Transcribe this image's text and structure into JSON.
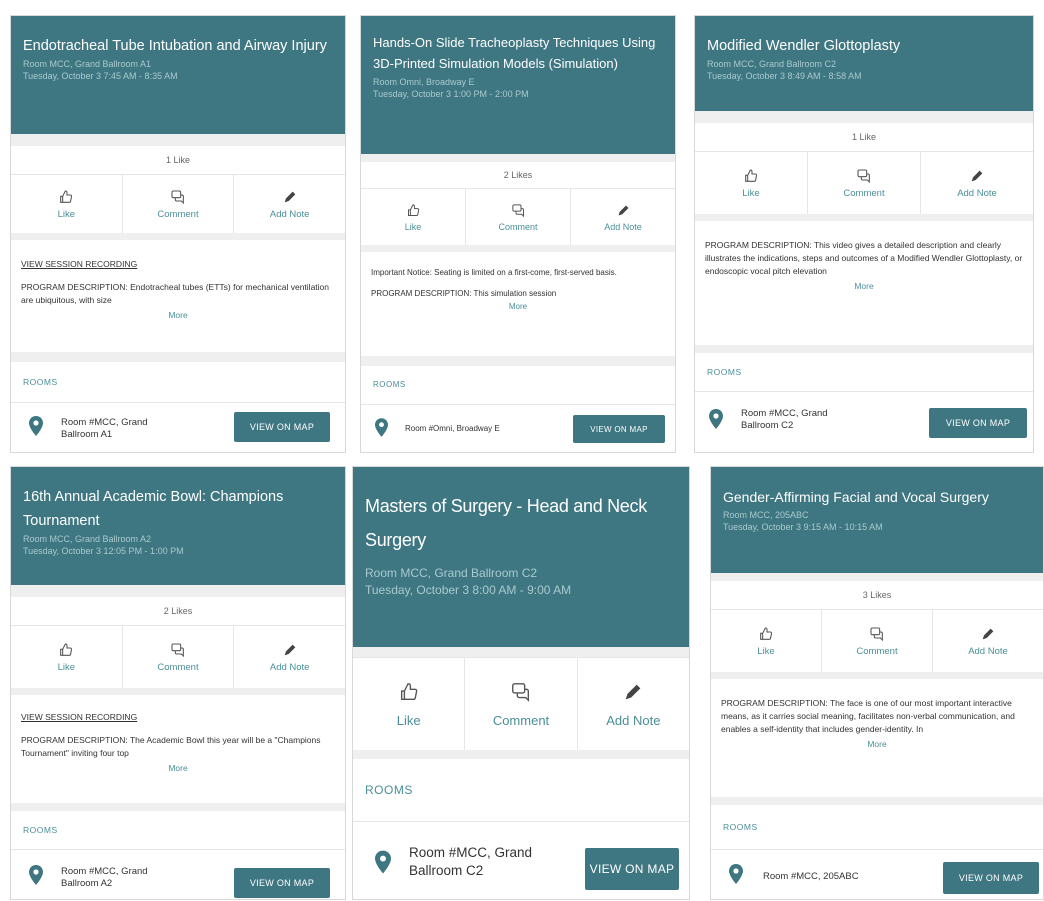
{
  "colors": {
    "header_bg": "#3e7681",
    "accent": "#4a8f98"
  },
  "actions": {
    "like": "Like",
    "comment": "Comment",
    "add_note": "Add Note"
  },
  "labels": {
    "rooms": "ROOMS",
    "view_on_map": "VIEW ON MAP",
    "more": "More",
    "view_recording": "VIEW SESSION RECORDING"
  },
  "icons": {
    "like": "thumbs-up-icon",
    "comment": "comment-icon",
    "note": "pencil-icon",
    "location": "map-pin-icon"
  },
  "sessions": [
    {
      "title": "Endotracheal Tube Intubation and Airway Injury",
      "room": "Room MCC, Grand Ballroom A1",
      "time": "Tuesday, October 3 7:45 AM - 8:35 AM",
      "likes": "1 Like",
      "recording": "VIEW SESSION RECORDING",
      "description": "PROGRAM DESCRIPTION: Endotracheal tubes (ETTs) for mechanical ventilation are ubiquitous, with size",
      "room_label": "Room #MCC, Grand Ballroom A1"
    },
    {
      "title": "Hands-On Slide Tracheoplasty Techniques Using 3D-Printed Simulation Models (Simulation)",
      "room": "Room Omni, Broadway E",
      "time": "Tuesday, October 3 1:00 PM - 2:00 PM",
      "likes": "2 Likes",
      "notice": "Important Notice: Seating is limited on a first-come, first-served basis.",
      "description": "PROGRAM DESCRIPTION: This simulation session",
      "room_label": "Room #Omni, Broadway E"
    },
    {
      "title": "Modified Wendler Glottoplasty",
      "room": "Room MCC, Grand Ballroom C2",
      "time": "Tuesday, October 3 8:49 AM - 8:58 AM",
      "likes": "1 Like",
      "description": "PROGRAM DESCRIPTION: This video gives a detailed description and clearly illustrates the indications, steps and outcomes of a Modified Wendler Glottoplasty, or endoscopic vocal pitch elevation",
      "room_label": "Room #MCC, Grand Ballroom C2"
    },
    {
      "title": "16th Annual Academic Bowl: Champions Tournament",
      "room": "Room MCC, Grand Ballroom A2",
      "time": "Tuesday, October 3 12:05 PM - 1:00 PM",
      "likes": "2 Likes",
      "recording": "VIEW SESSION RECORDING",
      "description": "PROGRAM DESCRIPTION: The Academic Bowl this year will be a \"Champions Tournament\" inviting four top",
      "room_label": "Room #MCC, Grand Ballroom A2"
    },
    {
      "title": "Masters of Surgery - Head and Neck Surgery",
      "room": "Room MCC, Grand Ballroom C2",
      "time": "Tuesday, October 3 8:00 AM - 9:00 AM",
      "room_label": "Room #MCC, Grand Ballroom C2"
    },
    {
      "title": "Gender-Affirming Facial and Vocal Surgery",
      "room": "Room MCC, 205ABC",
      "time": "Tuesday, October 3 9:15 AM - 10:15 AM",
      "likes": "3 Likes",
      "description": "PROGRAM DESCRIPTION: The face is one of our most important interactive means, as it carries social meaning, facilitates non-verbal communication, and enables a self-identity that includes gender-identity. In",
      "room_label": "Room #MCC, 205ABC"
    }
  ]
}
